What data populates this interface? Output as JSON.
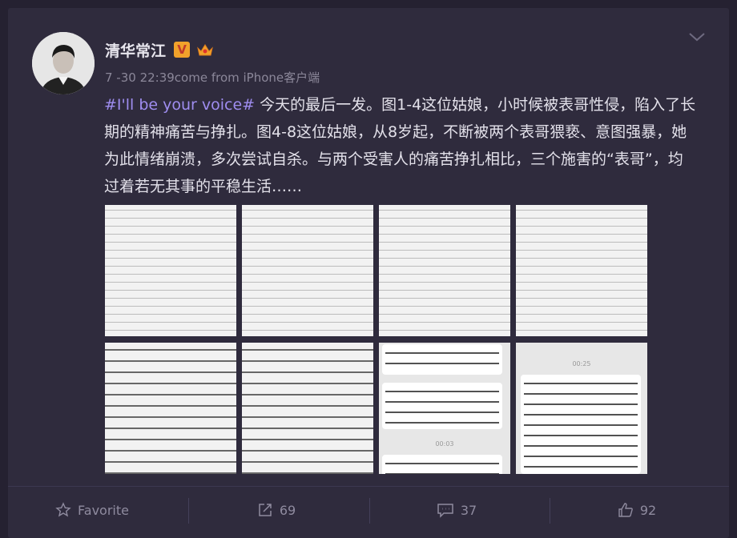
{
  "post": {
    "author": "清华常江",
    "verified_badge": "V",
    "meta": "7 -30 22:39come from iPhone客户端",
    "hashtag": "#I'll be your voice#",
    "body": " 今天的最后一发。图1-4这位姑娘，小时候被表哥性侵，陷入了长期的精神痛苦与挣扎。图4-8这位姑娘，从8岁起，不断被两个表哥猥亵、意图强暴，她为此情绪崩溃，多次尝试自杀。与两个受害人的痛苦挣扎相比，三个施害的“表哥”，均过着若无其事的平稳生活……"
  },
  "images": {
    "chat_timestamps": [
      "00:03",
      "00:25"
    ]
  },
  "actions": {
    "favorite": "Favorite",
    "repost": "69",
    "comment": "37",
    "like": "92"
  },
  "colors": {
    "background": "#252131",
    "card": "#2f2b3d",
    "hashtag": "#9f8df0",
    "verified": "#f1a22b"
  }
}
